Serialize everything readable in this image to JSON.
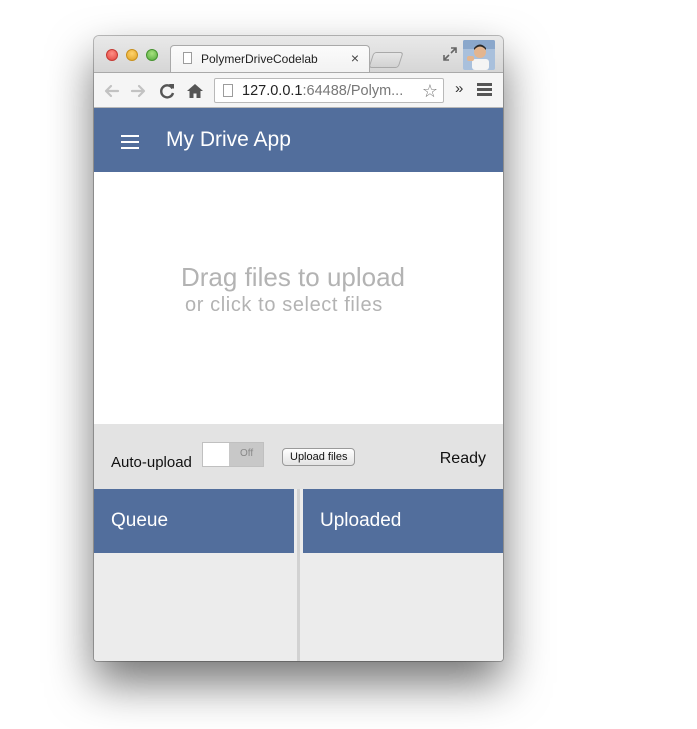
{
  "browser": {
    "tab": {
      "title": "PolymerDriveCodelab",
      "close_glyph": "×"
    },
    "address": {
      "host": "127.0.0.1",
      "rest": ":64488/Polym..."
    },
    "star_glyph": "☆",
    "overflow_glyph": "»",
    "icons": {
      "back": "back-arrow-icon",
      "forward": "forward-arrow-icon",
      "reload": "reload-icon",
      "home": "home-icon",
      "menu": "chrome-menu-icon",
      "fullscreen": "fullscreen-icon"
    }
  },
  "app": {
    "title": "My Drive App",
    "header_color": "#526e9c",
    "dropzone": {
      "main_text": "Drag files to upload",
      "sub_text": "or click to select files"
    },
    "controls": {
      "auto_upload_label": "Auto-upload",
      "toggle_state_text": "Off",
      "upload_button_label": "Upload files",
      "status": "Ready"
    },
    "panels": {
      "queue_title": "Queue",
      "uploaded_title": "Uploaded"
    }
  }
}
